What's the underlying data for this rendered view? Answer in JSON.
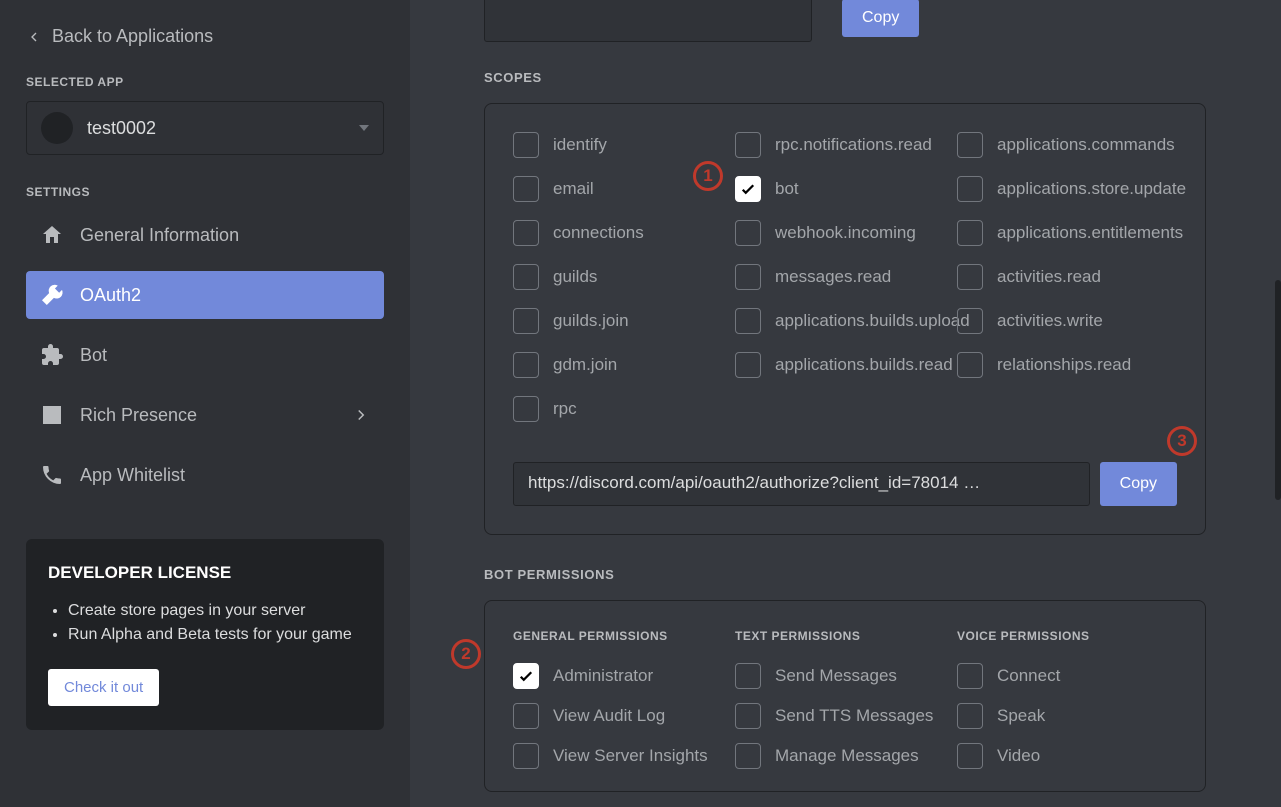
{
  "back_label": "Back to Applications",
  "selected_app_label": "SELECTED APP",
  "app_name": "test0002",
  "settings_label": "SETTINGS",
  "nav": {
    "general": "General Information",
    "oauth2": "OAuth2",
    "bot": "Bot",
    "rich": "Rich Presence",
    "whitelist": "App Whitelist"
  },
  "dev_license": {
    "title": "DEVELOPER LICENSE",
    "bullet1": "Create store pages in your server",
    "bullet2": "Run Alpha and Beta tests for your game",
    "cta": "Check it out"
  },
  "copy_label": "Copy",
  "scopes_label": "SCOPES",
  "scopes": {
    "col1": [
      "identify",
      "email",
      "connections",
      "guilds",
      "guilds.join",
      "gdm.join",
      "rpc"
    ],
    "col2": [
      "rpc.notifications.read",
      "bot",
      "webhook.incoming",
      "messages.read",
      "applications.builds.upload",
      "applications.builds.read"
    ],
    "col3": [
      "applications.commands",
      "applications.store.update",
      "applications.entitlements",
      "activities.read",
      "activities.write",
      "relationships.read"
    ]
  },
  "oauth_url": "https://discord.com/api/oauth2/authorize?client_id=78014 …",
  "bot_perms_label": "BOT PERMISSIONS",
  "perm_cols": {
    "general_label": "GENERAL PERMISSIONS",
    "general": [
      "Administrator",
      "View Audit Log",
      "View Server Insights"
    ],
    "text_label": "TEXT PERMISSIONS",
    "text": [
      "Send Messages",
      "Send TTS Messages",
      "Manage Messages"
    ],
    "voice_label": "VOICE PERMISSIONS",
    "voice": [
      "Connect",
      "Speak",
      "Video"
    ]
  },
  "annotations": {
    "one": "1",
    "two": "2",
    "three": "3"
  }
}
